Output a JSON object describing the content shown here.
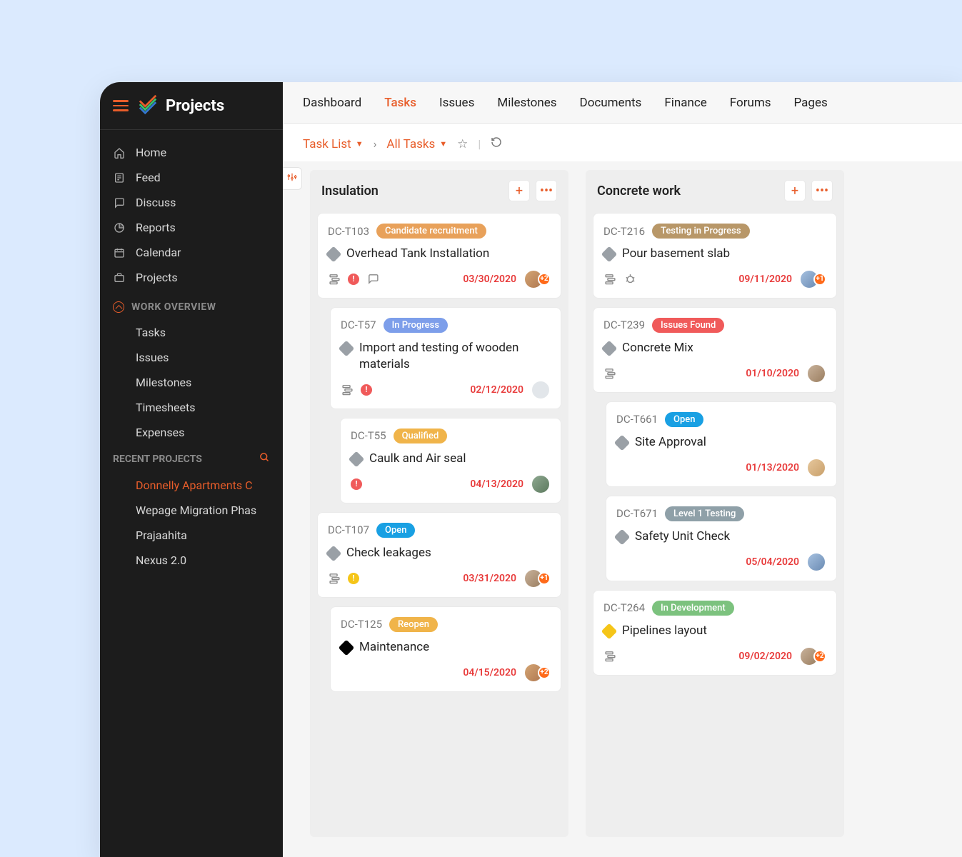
{
  "app_title": "Projects",
  "sidebar": {
    "main_items": [
      {
        "icon": "home",
        "label": "Home"
      },
      {
        "icon": "feed",
        "label": "Feed"
      },
      {
        "icon": "chat",
        "label": "Discuss"
      },
      {
        "icon": "reports",
        "label": "Reports"
      },
      {
        "icon": "calendar",
        "label": "Calendar"
      },
      {
        "icon": "projects",
        "label": "Projects"
      }
    ],
    "work_overview_title": "WORK OVERVIEW",
    "work_items": [
      "Tasks",
      "Issues",
      "Milestones",
      "Timesheets",
      "Expenses"
    ],
    "recent_title": "RECENT PROJECTS",
    "recent_items": [
      {
        "label": "Donnelly Apartments C",
        "active": true
      },
      {
        "label": "Wepage Migration Phas",
        "active": false
      },
      {
        "label": "Prajaahita",
        "active": false
      },
      {
        "label": "Nexus 2.0",
        "active": false
      }
    ]
  },
  "topnav": [
    "Dashboard",
    "Tasks",
    "Issues",
    "Milestones",
    "Documents",
    "Finance",
    "Forums",
    "Pages"
  ],
  "topnav_active": "Tasks",
  "breadcrumb": {
    "first": "Task List",
    "second": "All Tasks"
  },
  "columns": [
    {
      "title": "Insulation",
      "cards": [
        {
          "indent": 0,
          "id": "DC-T103",
          "status": {
            "label": "Candidate recruitment",
            "color": "#e8a15a"
          },
          "priority": "gray",
          "title": "Overhead Tank Installation",
          "icons": [
            "subtask",
            "flag-red",
            "comment"
          ],
          "due": "03/30/2020",
          "avatars": [
            "a2"
          ],
          "more": "+2"
        },
        {
          "indent": 1,
          "id": "DC-T57",
          "status": {
            "label": "In Progress",
            "color": "#7d9eea"
          },
          "priority": "gray",
          "title": "Import and testing of wooden materials",
          "icons": [
            "subtask",
            "flag-red"
          ],
          "due": "02/12/2020",
          "avatars": [
            "ph"
          ],
          "more": null
        },
        {
          "indent": 2,
          "id": "DC-T55",
          "status": {
            "label": "Qualified",
            "color": "#f0b44a"
          },
          "priority": "gray",
          "title": "Caulk and Air seal",
          "icons": [
            "flag-red"
          ],
          "due": "04/13/2020",
          "avatars": [
            "a3"
          ],
          "more": null
        },
        {
          "indent": 0,
          "id": "DC-T107",
          "status": {
            "label": "Open",
            "color": "#19a0e3"
          },
          "priority": "gray",
          "title": "Check leakages",
          "icons": [
            "subtask",
            "flag-yellow"
          ],
          "due": "03/31/2020",
          "avatars": [
            "a4"
          ],
          "more": "+1"
        },
        {
          "indent": 1,
          "id": "DC-T125",
          "status": {
            "label": "Reopen",
            "color": "#f0b44a"
          },
          "priority": "black",
          "title": "Maintenance",
          "icons": [],
          "due": "04/15/2020",
          "avatars": [
            "a2"
          ],
          "more": "+2"
        }
      ]
    },
    {
      "title": "Concrete work",
      "cards": [
        {
          "indent": 0,
          "id": "DC-T216",
          "status": {
            "label": "Testing in Progress",
            "color": "#b89768"
          },
          "priority": "gray",
          "title": "Pour basement slab",
          "icons": [
            "subtask",
            "bug"
          ],
          "due": "09/11/2020",
          "avatars": [
            "a6"
          ],
          "more": "+1"
        },
        {
          "indent": 0,
          "id": "DC-T239",
          "status": {
            "label": "Issues Found",
            "color": "#f05a5a"
          },
          "priority": "gray",
          "title": "Concrete Mix",
          "icons": [
            "subtask"
          ],
          "due": "01/10/2020",
          "avatars": [
            "a4"
          ],
          "more": null
        },
        {
          "indent": 1,
          "id": "DC-T661",
          "status": {
            "label": "Open",
            "color": "#19a0e3"
          },
          "priority": "gray",
          "title": "Site Approval",
          "icons": [],
          "due": "01/13/2020",
          "avatars": [
            "a5"
          ],
          "more": null
        },
        {
          "indent": 1,
          "id": "DC-T671",
          "status": {
            "label": "Level 1 Testing",
            "color": "#8fa0a8"
          },
          "priority": "gray",
          "title": "Safety Unit Check",
          "icons": [],
          "due": "05/04/2020",
          "avatars": [
            "a6"
          ],
          "more": null
        },
        {
          "indent": 0,
          "id": "DC-T264",
          "status": {
            "label": "In Development",
            "color": "#7cc27e"
          },
          "priority": "yellow",
          "title": "Pipelines layout",
          "icons": [
            "subtask"
          ],
          "due": "09/02/2020",
          "avatars": [
            "a4"
          ],
          "more": "+2"
        }
      ]
    }
  ]
}
